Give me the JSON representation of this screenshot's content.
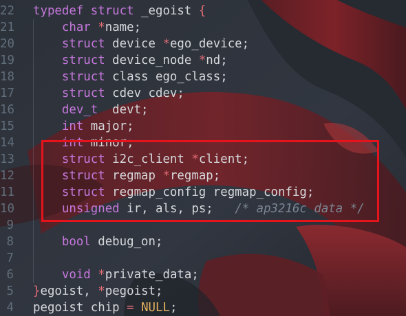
{
  "editor": {
    "accent_colors": {
      "keyword": "#c678dd",
      "operator": "#e06c75",
      "comment": "#7b8593",
      "constant": "#e5b35e",
      "highlight_box": "#e5141c"
    },
    "lines": [
      {
        "num": "22",
        "tokens": [
          {
            "t": "typedef ",
            "c": "kw"
          },
          {
            "t": "struct ",
            "c": "kw"
          },
          {
            "t": "_egoist ",
            "c": "pl"
          },
          {
            "t": "{",
            "c": "op"
          }
        ]
      },
      {
        "num": "21",
        "tokens": [
          {
            "t": "    char ",
            "c": "kw"
          },
          {
            "t": "*",
            "c": "op"
          },
          {
            "t": "name;",
            "c": "pl"
          }
        ]
      },
      {
        "num": "20",
        "tokens": [
          {
            "t": "    struct ",
            "c": "kw"
          },
          {
            "t": "device ",
            "c": "pl"
          },
          {
            "t": "*",
            "c": "op"
          },
          {
            "t": "ego_device;",
            "c": "pl"
          }
        ]
      },
      {
        "num": "19",
        "tokens": [
          {
            "t": "    struct ",
            "c": "kw"
          },
          {
            "t": "device_node ",
            "c": "pl"
          },
          {
            "t": "*",
            "c": "op"
          },
          {
            "t": "nd;",
            "c": "pl"
          }
        ]
      },
      {
        "num": "18",
        "tokens": [
          {
            "t": "    struct ",
            "c": "kw"
          },
          {
            "t": "class ego_class;",
            "c": "pl"
          }
        ]
      },
      {
        "num": "17",
        "tokens": [
          {
            "t": "    struct ",
            "c": "kw"
          },
          {
            "t": "cdev cdev;",
            "c": "pl"
          }
        ]
      },
      {
        "num": "16",
        "tokens": [
          {
            "t": "    dev_t ",
            "c": "kw"
          },
          {
            "t": " devt;",
            "c": "pl"
          }
        ]
      },
      {
        "num": "15",
        "tokens": [
          {
            "t": "    int ",
            "c": "kw"
          },
          {
            "t": "major;",
            "c": "pl"
          }
        ]
      },
      {
        "num": "14",
        "tokens": [
          {
            "t": "    int ",
            "c": "kw"
          },
          {
            "t": "minor;",
            "c": "pl"
          }
        ]
      },
      {
        "num": "13",
        "tokens": [
          {
            "t": "    struct ",
            "c": "kw"
          },
          {
            "t": "i2c_client ",
            "c": "pl"
          },
          {
            "t": "*",
            "c": "op"
          },
          {
            "t": "client;",
            "c": "pl"
          }
        ]
      },
      {
        "num": "12",
        "tokens": [
          {
            "t": "    struct ",
            "c": "kw"
          },
          {
            "t": "regmap ",
            "c": "pl"
          },
          {
            "t": "*",
            "c": "op"
          },
          {
            "t": "regmap;",
            "c": "pl"
          }
        ]
      },
      {
        "num": "11",
        "tokens": [
          {
            "t": "    struct ",
            "c": "kw"
          },
          {
            "t": "regmap_config regmap_config;",
            "c": "pl"
          }
        ]
      },
      {
        "num": "10",
        "tokens": [
          {
            "t": "    unsigned ",
            "c": "kw"
          },
          {
            "t": "ir, als, ps;   ",
            "c": "pl"
          },
          {
            "t": "/* ap3216c data */",
            "c": "cm"
          }
        ]
      },
      {
        "num": "9",
        "tokens": []
      },
      {
        "num": "8",
        "tokens": [
          {
            "t": "    bool ",
            "c": "kw"
          },
          {
            "t": "debug_on;",
            "c": "pl"
          }
        ]
      },
      {
        "num": "7",
        "tokens": []
      },
      {
        "num": "6",
        "tokens": [
          {
            "t": "    void ",
            "c": "kw"
          },
          {
            "t": "*",
            "c": "op"
          },
          {
            "t": "private_data;",
            "c": "pl"
          }
        ]
      },
      {
        "num": "5",
        "tokens": [
          {
            "t": "}",
            "c": "op"
          },
          {
            "t": "egoist, ",
            "c": "pl"
          },
          {
            "t": "*",
            "c": "op"
          },
          {
            "t": "pegoist;",
            "c": "pl"
          }
        ]
      },
      {
        "num": "4",
        "tokens": [
          {
            "t": "pegoist chip ",
            "c": "pl"
          },
          {
            "t": "= ",
            "c": "op"
          },
          {
            "t": "NULL",
            "c": "nu"
          },
          {
            "t": ";",
            "c": "pl"
          }
        ]
      }
    ]
  }
}
